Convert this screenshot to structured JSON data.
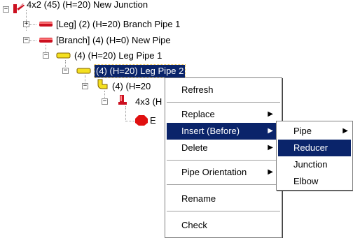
{
  "tree": {
    "nodes": [
      {
        "label": "4x2 (45)  (H=20) New Junction"
      },
      {
        "label": "[Leg] (2) (H=20) Branch Pipe 1"
      },
      {
        "label": "[Branch] (4) (H=0) New Pipe"
      },
      {
        "label": "(4) (H=20) Leg Pipe 1"
      },
      {
        "label": "(4) (H=20) Leg Pipe 2"
      },
      {
        "label": "(4) (H=20"
      },
      {
        "label": "4x3 (H"
      },
      {
        "label": "E"
      }
    ]
  },
  "context_menu": {
    "items": [
      {
        "label": "Refresh"
      },
      {
        "label": "Replace"
      },
      {
        "label": "Insert (Before)"
      },
      {
        "label": "Delete"
      },
      {
        "label": "Pipe Orientation"
      },
      {
        "label": "Rename"
      },
      {
        "label": "Check"
      }
    ],
    "highlighted": "Insert (Before)"
  },
  "submenu": {
    "items": [
      {
        "label": "Pipe"
      },
      {
        "label": "Reducer"
      },
      {
        "label": "Junction"
      },
      {
        "label": "Elbow"
      }
    ],
    "highlighted": "Reducer"
  },
  "glyphs": {
    "expanded": "−",
    "collapsed": "+",
    "submenu_arrow": "▶"
  },
  "colors": {
    "selection": "#0a246a",
    "pipe_red": "#cc1020",
    "pipe_yellow": "#f4e020",
    "elbow_red": "#e01010"
  }
}
